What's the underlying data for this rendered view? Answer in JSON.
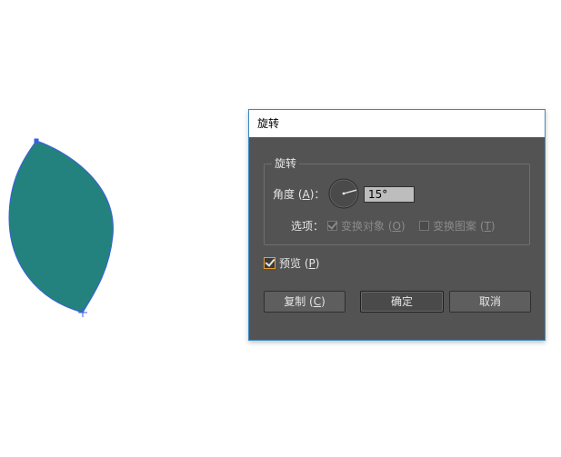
{
  "canvas": {
    "leaf_color": "#23827d",
    "anchor_color": "#3a5fe0"
  },
  "dialog": {
    "title": "旋转",
    "group_label": "旋转",
    "angle": {
      "label": "角度",
      "mnemonic": "A",
      "value": "15°"
    },
    "options": {
      "label": "选项：",
      "transform_objects": {
        "label": "变换对象",
        "mnemonic": "O",
        "checked": true,
        "enabled": false
      },
      "transform_patterns": {
        "label": "变换图案",
        "mnemonic": "T",
        "checked": false,
        "enabled": false
      }
    },
    "preview": {
      "label": "预览",
      "mnemonic": "P",
      "checked": true
    },
    "buttons": {
      "copy": {
        "label": "复制",
        "mnemonic": "C"
      },
      "ok": {
        "label": "确定"
      },
      "cancel": {
        "label": "取消"
      }
    }
  }
}
